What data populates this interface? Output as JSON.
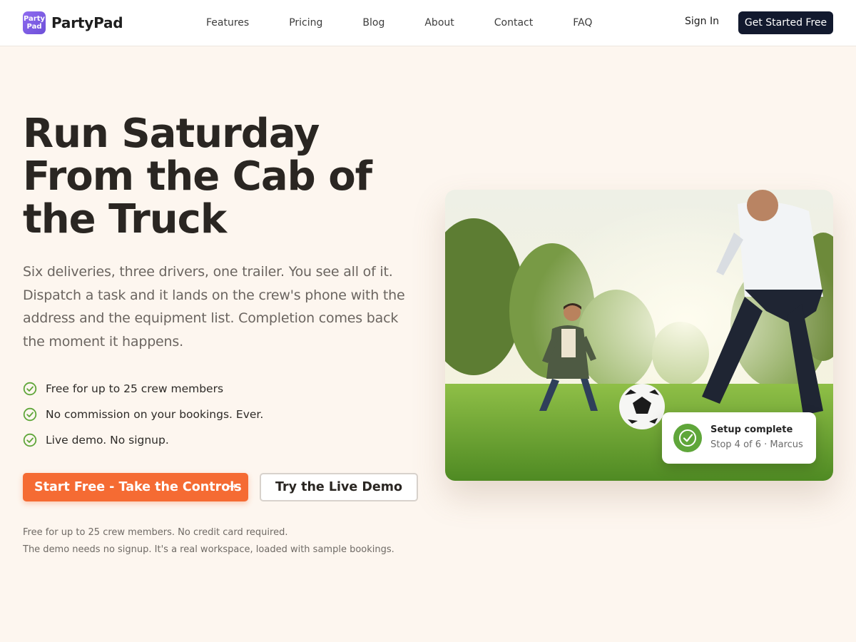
{
  "brand": {
    "logo_line1": "Party",
    "logo_line2": "Pad",
    "name": "PartyPad"
  },
  "nav": {
    "items": [
      "Features",
      "Pricing",
      "Blog",
      "About",
      "Contact",
      "FAQ"
    ]
  },
  "header": {
    "signin_label": "Sign In",
    "cta_label": "Get Started Free"
  },
  "hero": {
    "title": "Run Saturday From the Cab of the Truck",
    "lead": "Six deliveries, three drivers, one trailer. You see all of it. Dispatch a task and it lands on the crew's phone with the address and the equipment list. Completion comes back the moment it happens.",
    "checks": [
      "Free for up to 25 crew members",
      "No commission on your bookings. Ever.",
      "Live demo. No signup."
    ],
    "primary_cta": "Start Free - Take the Controls",
    "primary_cta_icon": "arrow-right-icon",
    "secondary_cta": "Try the Live Demo",
    "fine_print_1": "Free for up to 25 crew members. No credit card required.",
    "fine_print_2": "The demo needs no signup. It's a real workspace, loaded with sample bookings."
  },
  "toast": {
    "title": "Setup complete",
    "subtitle": "Stop 4 of 6 · Marcus",
    "icon": "check-circle-icon"
  },
  "colors": {
    "accent": "#f56b33",
    "dark": "#12192e",
    "success": "#5fa63a",
    "brand": "#7b5ce6",
    "background": "#fdf6ef"
  }
}
